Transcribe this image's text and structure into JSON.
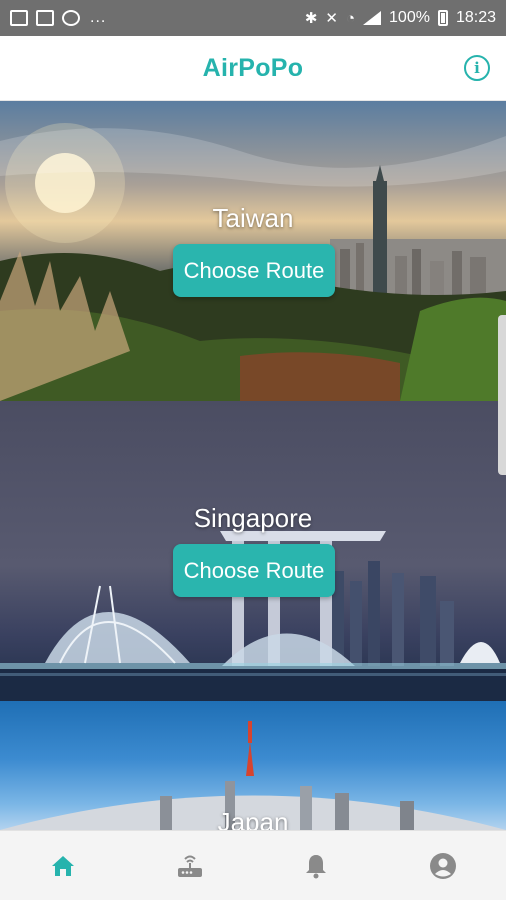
{
  "status_bar": {
    "more": "...",
    "battery_percent": "100%",
    "time": "18:23"
  },
  "header": {
    "title": "AirPoPo",
    "info_label": "i"
  },
  "destinations": [
    {
      "name": "Taiwan",
      "button_label": "Choose Route"
    },
    {
      "name": "Singapore",
      "button_label": "Choose Route"
    },
    {
      "name": "Japan"
    }
  ],
  "bottom_nav": [
    {
      "icon": "home-icon",
      "active": true
    },
    {
      "icon": "router-icon",
      "active": false
    },
    {
      "icon": "bell-icon",
      "active": false
    },
    {
      "icon": "account-icon",
      "active": false
    }
  ],
  "colors": {
    "accent": "#26b3ad",
    "nav_inactive": "#8a8a8a",
    "status_bar": "#6f6f6f"
  }
}
